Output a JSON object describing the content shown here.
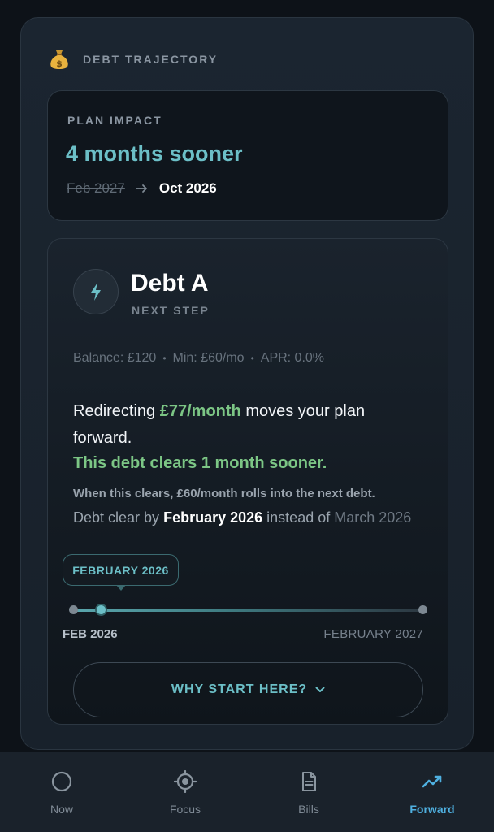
{
  "panel": {
    "title": "DEBT TRAJECTORY",
    "header_icon": "money-bag-icon"
  },
  "impact": {
    "label": "PLAN IMPACT",
    "headline": "4 months sooner",
    "old_date": "Feb 2027",
    "new_date": "Oct 2026"
  },
  "debt": {
    "name": "Debt A",
    "step_label": "NEXT STEP",
    "icon": "bolt-icon",
    "meta": {
      "balance": "Balance: £120",
      "min": "Min: £60/mo",
      "apr": "APR: 0.0%"
    },
    "redirect_prefix": "Redirecting",
    "redirect_amount": "£77/month",
    "redirect_suffix": "moves your plan forward.",
    "sooner": "This debt clears 1 month sooner.",
    "rolls": "When this clears, £60/month rolls into the next debt.",
    "clear_prefix": "Debt clear by",
    "clear_date": "February 2026",
    "clear_middle": "instead of",
    "clear_old": "March 2026"
  },
  "timeline": {
    "tooltip": "FEBRUARY 2026",
    "start_label": "FEB 2026",
    "end_label": "FEBRUARY 2027",
    "progress": 0.08
  },
  "why_button": {
    "label": "WHY START HERE?"
  },
  "nav": {
    "items": [
      {
        "label": "Now",
        "icon": "circle-icon",
        "active": false
      },
      {
        "label": "Focus",
        "icon": "target-icon",
        "active": false
      },
      {
        "label": "Bills",
        "icon": "document-icon",
        "active": false
      },
      {
        "label": "Forward",
        "icon": "trending-up-icon",
        "active": true
      }
    ]
  },
  "colors": {
    "accent": "#6cbfc7",
    "positive": "#7cc685",
    "nav_active": "#4fb0e0"
  }
}
